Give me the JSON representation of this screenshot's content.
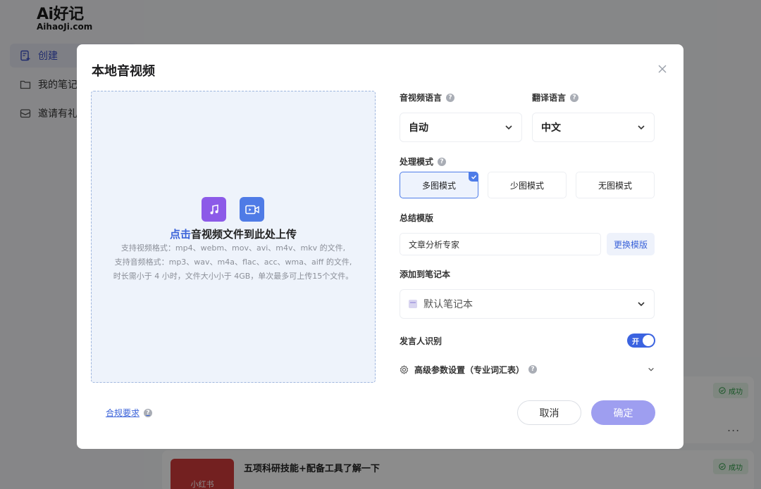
{
  "background": {
    "logo": {
      "main": "Ai好记",
      "sub": "AihaoJi.com"
    },
    "nav": [
      {
        "label": "创建",
        "active": true
      },
      {
        "label": "我的笔记"
      },
      {
        "label": "邀请有礼"
      }
    ],
    "cards": [
      {
        "thumb_text": "小红书",
        "title": "五项科研技能+配备工具了解一下",
        "status": "成功"
      }
    ],
    "extra_status": "成功",
    "more": "..."
  },
  "modal": {
    "title": "本地音视频",
    "upload": {
      "highlight": "点击",
      "main_text": "音视频文件到此处上传",
      "video_formats": "支持视频格式：mp4、webm、mov、avi、m4v、mkv 的文件,",
      "audio_formats": "支持音频格式：mp3、wav、m4a、flac、acc、wma、aiff 的文件,",
      "limits": "时长需小于 4 小时，文件大小小于 4GB，单次最多可上传15个文件。"
    },
    "compliance": "合规要求",
    "language": {
      "label": "音视频语言",
      "value": "自动"
    },
    "translation": {
      "label": "翻译语言",
      "value": "中文"
    },
    "mode": {
      "label": "处理模式",
      "options": [
        "多图模式",
        "少图模式",
        "无图模式"
      ],
      "selected": "多图模式"
    },
    "template": {
      "label": "总结模版",
      "value": "文章分析专家",
      "change_button": "更换模版"
    },
    "notebook": {
      "label": "添加到笔记本",
      "value": "默认笔记本"
    },
    "speaker": {
      "label": "发言人识别",
      "toggle_text": "开",
      "enabled": true
    },
    "advanced": {
      "label": "高级参数设置（专业词汇表）"
    },
    "buttons": {
      "cancel": "取消",
      "confirm": "确定"
    }
  },
  "colors": {
    "accent": "#3b63d9",
    "confirm_disabled": "#9e9ef0",
    "dropzone_bg": "#eef3fb",
    "music_icon_bg": "#8c5ae8",
    "video_icon_bg": "#4f7be6",
    "success": "#2f9b47"
  }
}
